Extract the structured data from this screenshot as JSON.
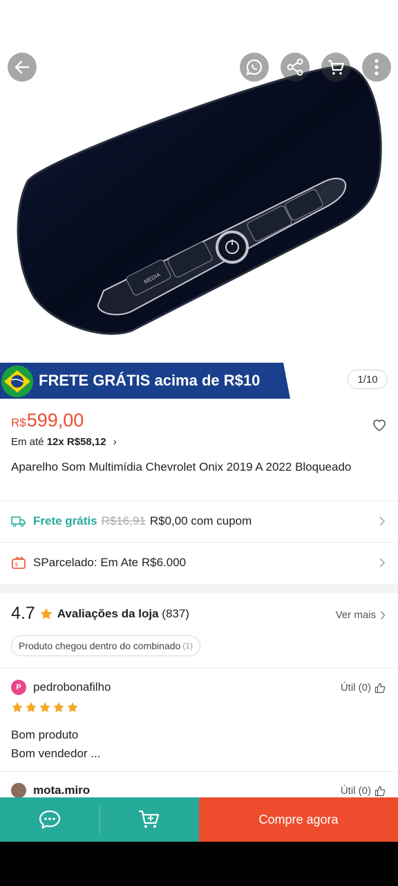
{
  "header": {
    "icons": [
      "back-arrow-icon",
      "whatsapp-icon",
      "share-icon",
      "cart-icon",
      "more-options-icon"
    ]
  },
  "gallery": {
    "pager": "1/10"
  },
  "banner": {
    "flag": "brazil-flag-icon",
    "text_bold": "FRETE GRÁTIS",
    "text_rest": "acima de R$10"
  },
  "product": {
    "currency": "R$",
    "price": "599,00",
    "installment_prefix": "Em até",
    "installment_value": "12x R$58,12",
    "title": "Aparelho Som Multimídia Chevrolet Onix 2019 A 2022 Bloqueado"
  },
  "shipping": {
    "label": "Frete grátis",
    "old_price": "R$16,91",
    "new_price": "R$0,00 com cupom"
  },
  "installments": {
    "label": "SParcelado: Em Ate R$6.000"
  },
  "reviews": {
    "score": "4.7",
    "label": "Avaliações da loja",
    "count": "(837)",
    "see_more": "Ver mais",
    "chip_text": "Produto chegou dentro do combinado",
    "chip_count": "(1)",
    "items": [
      {
        "avatar_letter": "P",
        "user": "pedrobonafilho",
        "useful": "Útil (0)",
        "stars": 5,
        "text_line1": "Bom produto",
        "text_line2": "Bom vendedor ..."
      },
      {
        "user": "mota.miro",
        "useful": "Útil (0)"
      }
    ]
  },
  "bottom": {
    "buy_label": "Compre agora"
  },
  "colors": {
    "accent": "#ee4d2d",
    "teal": "#26aa99",
    "banner_blue": "#1a3f8c",
    "star": "#f5a623"
  }
}
